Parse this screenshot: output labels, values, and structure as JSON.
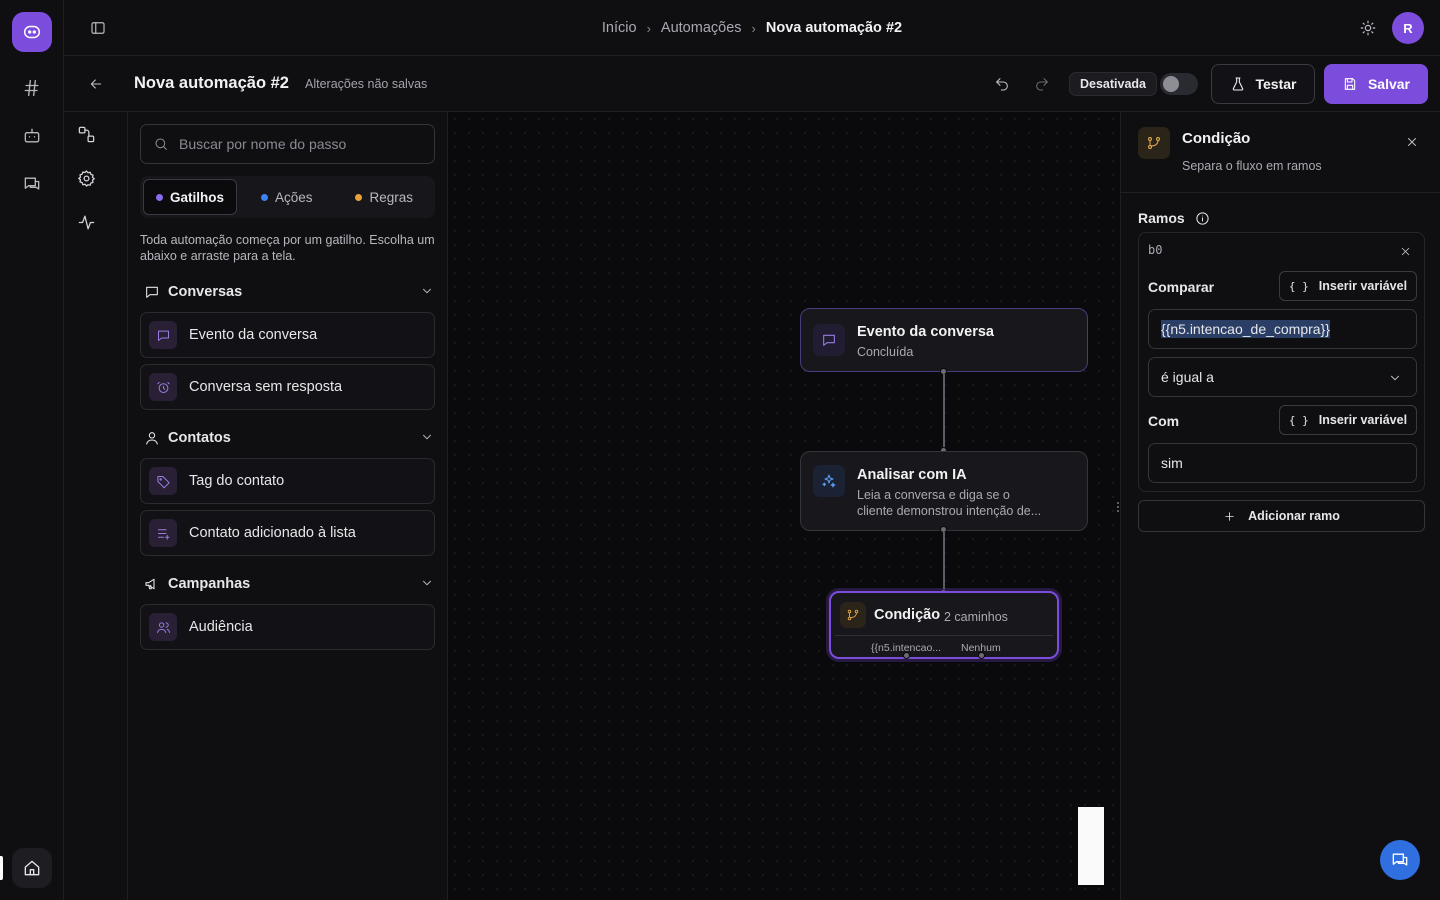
{
  "topbar": {
    "breadcrumb": [
      "Início",
      "Automações",
      "Nova automação #2"
    ],
    "avatar_initial": "R"
  },
  "subbar": {
    "title": "Nova automação #2",
    "unsaved": "Alterações não salvas",
    "status": "Desativada",
    "active": false,
    "test_label": "Testar",
    "save_label": "Salvar"
  },
  "steps": {
    "search_placeholder": "Buscar por nome do passo",
    "tabs": [
      {
        "label": "Gatilhos",
        "color": "#8b6cf0"
      },
      {
        "label": "Ações",
        "color": "#3b82f6"
      },
      {
        "label": "Regras",
        "color": "#e8a23a"
      }
    ],
    "description": "Toda automação começa por um gatilho. Escolha um abaixo e arraste para a tela.",
    "groups": [
      {
        "title": "Conversas",
        "items": [
          "Evento da conversa",
          "Conversa sem resposta"
        ]
      },
      {
        "title": "Contatos",
        "items": [
          "Tag do contato",
          "Contato adicionado à lista"
        ]
      },
      {
        "title": "Campanhas",
        "items": [
          "Audiência"
        ]
      }
    ]
  },
  "canvas": {
    "node1": {
      "title": "Evento da conversa",
      "subtitle": "Concluída"
    },
    "node2": {
      "title": "Analisar com IA",
      "subtitle_line1": "Leia a conversa e diga se o",
      "subtitle_line2": "cliente demonstrou intenção de..."
    },
    "node3": {
      "title": "Condição",
      "paths": "2 caminhos",
      "branch_a": "{{n5.intencao...",
      "branch_b": "Nenhum"
    }
  },
  "panel": {
    "title": "Condição",
    "subtitle": "Separa o fluxo em ramos",
    "section": "Ramos",
    "branch_id": "b0",
    "compare_label": "Comparar",
    "insert_var": "Inserir variável",
    "compare_value": "{{n5.intencao_de_compra}}",
    "operator": "é igual a",
    "with_label": "Com",
    "with_value": "sim",
    "add_branch": "Adicionar ramo"
  }
}
